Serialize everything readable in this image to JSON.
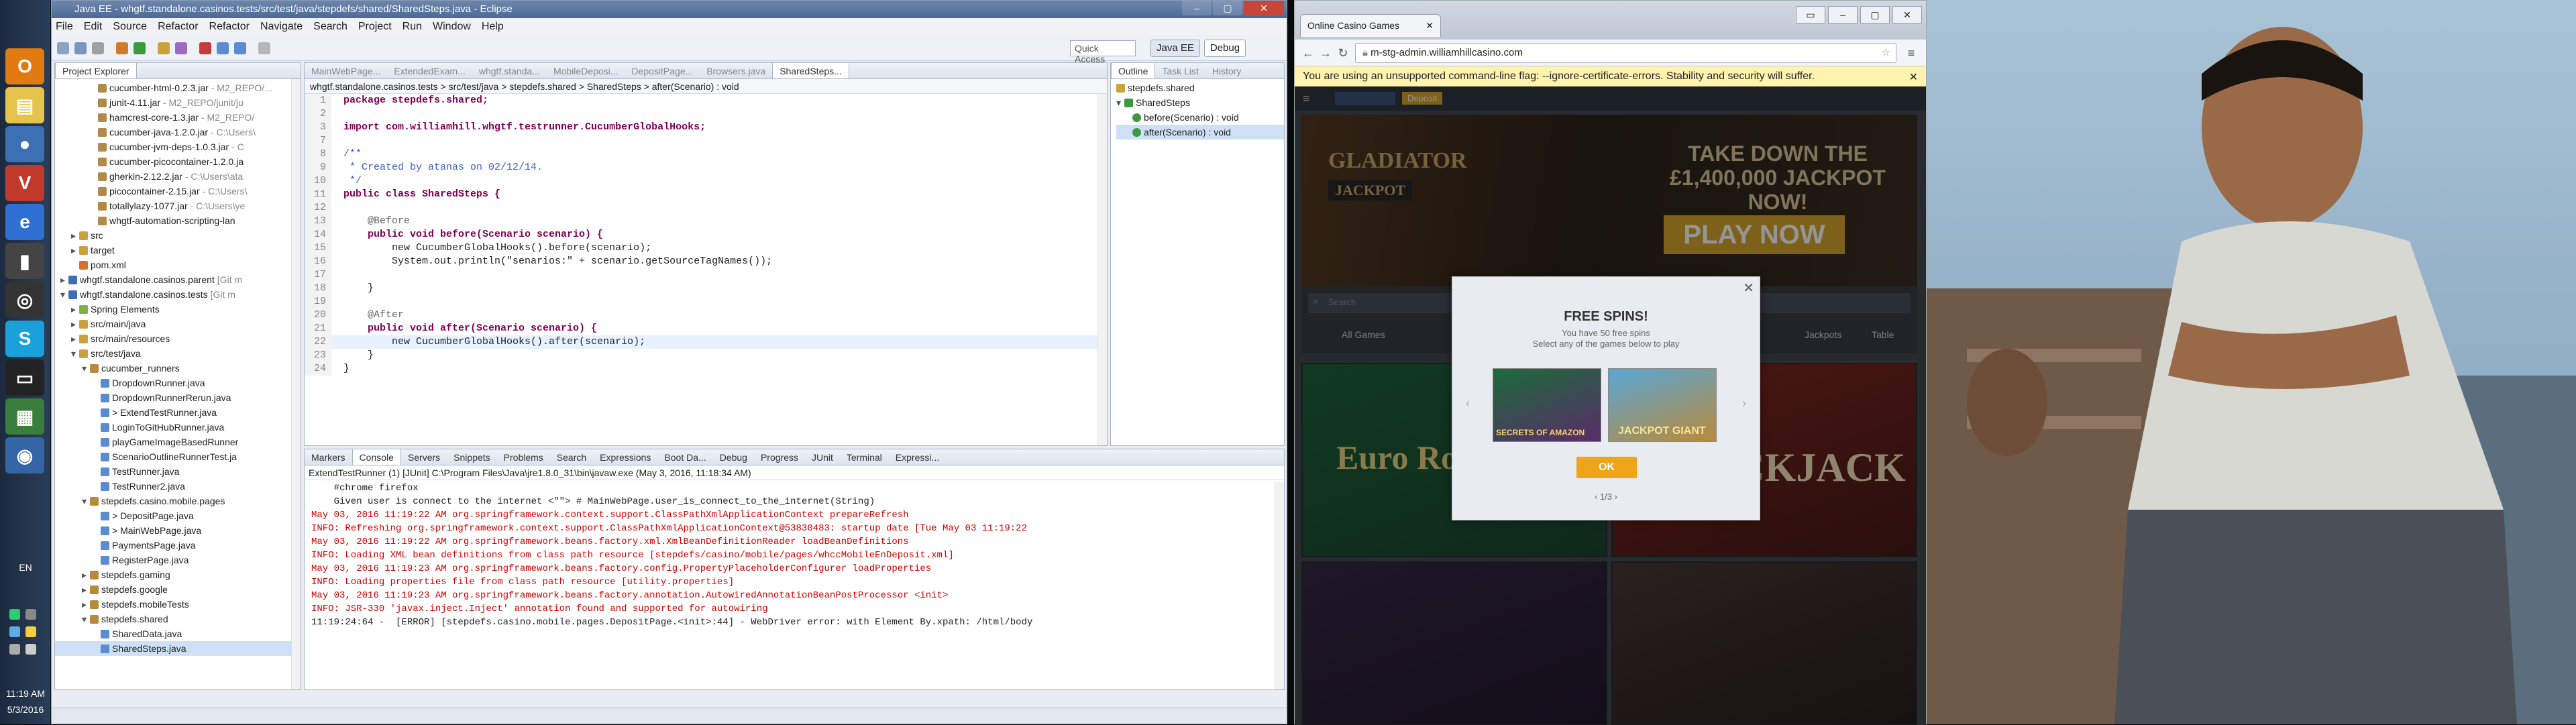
{
  "taskbar": {
    "language": "EN",
    "time": "11:19 AM",
    "date": "5/3/2016"
  },
  "eclipse": {
    "title": "Java EE - whgtf.standalone.casinos.tests/src/test/java/stepdefs/shared/SharedSteps.java - Eclipse",
    "menu": [
      "File",
      "Edit",
      "Source",
      "Refactor",
      "Refactor",
      "Navigate",
      "Search",
      "Project",
      "Run",
      "Window",
      "Help"
    ],
    "quick_access": "Quick Access",
    "perspectives": [
      "Java EE",
      "Debug"
    ],
    "project_explorer": {
      "title": "Project Explorer",
      "tabs_dim": [
        "MainWebPage...",
        "ExtendedExam...",
        "whgtf.standa...",
        "MobileDeposi...",
        "DepositPage...",
        "Browsers.java"
      ],
      "rows": [
        {
          "t": "cucumber-html-0.2.3.jar",
          "s": " - M2_REPO/..."
        },
        {
          "t": "junit-4.11.jar",
          "s": " - M2_REPO/junit/ju"
        },
        {
          "t": "hamcrest-core-1.3.jar",
          "s": " - M2_REPO/"
        },
        {
          "t": "cucumber-java-1.2.0.jar",
          "s": " - C:\\Users\\"
        },
        {
          "t": "cucumber-jvm-deps-1.0.3.jar",
          "s": " - C"
        },
        {
          "t": "cucumber-picocontainer-1.2.0.ja",
          "s": ""
        },
        {
          "t": "gherkin-2.12.2.jar",
          "s": " - C:\\Users\\ata"
        },
        {
          "t": "picocontainer-2.15.jar",
          "s": " - C:\\Users\\"
        },
        {
          "t": "totallylazy-1077.jar",
          "s": " - C:\\Users\\ye"
        },
        {
          "t": "whgtf-automation-scripting-lan",
          "s": ""
        },
        {
          "t": "src",
          "s": ""
        },
        {
          "t": "target",
          "s": ""
        },
        {
          "t": "pom.xml",
          "s": ""
        },
        {
          "t": "whgtf.standalone.casinos.parent",
          "s": " [Git m"
        },
        {
          "t": "whgtf.standalone.casinos.tests",
          "s": " [Git m"
        },
        {
          "t": "Spring Elements",
          "s": ""
        },
        {
          "t": "src/main/java",
          "s": ""
        },
        {
          "t": "src/main/resources",
          "s": ""
        },
        {
          "t": "src/test/java",
          "s": ""
        },
        {
          "t": "cucumber_runners",
          "s": ""
        },
        {
          "t": "DropdownRunner.java",
          "s": ""
        },
        {
          "t": "DropdownRunnerRerun.java",
          "s": ""
        },
        {
          "t": "> ExtendTestRunner.java",
          "s": ""
        },
        {
          "t": "LoginToGitHubRunner.java",
          "s": ""
        },
        {
          "t": "playGameImageBasedRunner",
          "s": ""
        },
        {
          "t": "ScenarioOutlineRunnerTest.ja",
          "s": ""
        },
        {
          "t": "TestRunner.java",
          "s": ""
        },
        {
          "t": "TestRunner2.java",
          "s": ""
        },
        {
          "t": "stepdefs.casino.mobile.pages",
          "s": ""
        },
        {
          "t": "> DepositPage.java",
          "s": ""
        },
        {
          "t": "> MainWebPage.java",
          "s": ""
        },
        {
          "t": "PaymentsPage.java",
          "s": ""
        },
        {
          "t": "RegisterPage.java",
          "s": ""
        },
        {
          "t": "stepdefs.gaming",
          "s": ""
        },
        {
          "t": "stepdefs.google",
          "s": ""
        },
        {
          "t": "stepdefs.mobileTests",
          "s": ""
        },
        {
          "t": "stepdefs.shared",
          "s": ""
        },
        {
          "t": "SharedData.java",
          "s": ""
        },
        {
          "t": "SharedSteps.java",
          "s": ""
        }
      ]
    },
    "editor": {
      "active_tab": "SharedSteps...",
      "breadcrumb": "whgtf.standalone.casinos.tests  >  src/test/java  >  stepdefs.shared  >  SharedSteps  >  after(Scenario) : void",
      "lines": [
        {
          "n": "1",
          "c": "package stepdefs.shared;"
        },
        {
          "n": "2",
          "c": ""
        },
        {
          "n": "3",
          "c": "import com.williamhill.whgtf.testrunner.CucumberGlobalHooks;"
        },
        {
          "n": "7",
          "c": ""
        },
        {
          "n": "8",
          "c": "/**"
        },
        {
          "n": "9",
          "c": " * Created by atanas on 02/12/14."
        },
        {
          "n": "10",
          "c": " */"
        },
        {
          "n": "11",
          "c": "public class SharedSteps {"
        },
        {
          "n": "12",
          "c": ""
        },
        {
          "n": "13",
          "c": "    @Before"
        },
        {
          "n": "14",
          "c": "    public void before(Scenario scenario) {"
        },
        {
          "n": "15",
          "c": "        new CucumberGlobalHooks().before(scenario);"
        },
        {
          "n": "16",
          "c": "        System.out.println(\"senarios:\" + scenario.getSourceTagNames());"
        },
        {
          "n": "17",
          "c": ""
        },
        {
          "n": "18",
          "c": "    }"
        },
        {
          "n": "19",
          "c": ""
        },
        {
          "n": "20",
          "c": "    @After"
        },
        {
          "n": "21",
          "c": "    public void after(Scenario scenario) {"
        },
        {
          "n": "22",
          "c": "        new CucumberGlobalHooks().after(scenario);"
        },
        {
          "n": "23",
          "c": "    }"
        },
        {
          "n": "24",
          "c": "}"
        }
      ]
    },
    "outline": {
      "tabs": [
        "Outline",
        "Task List",
        "History"
      ],
      "rows": [
        "stepdefs.shared",
        "SharedSteps",
        "before(Scenario) : void",
        "after(Scenario) : void"
      ]
    },
    "console": {
      "tabs": [
        "Markers",
        "Console",
        "Servers",
        "Snippets",
        "Problems",
        "Search",
        "Expressions",
        "Boot Da...",
        "Debug",
        "Progress",
        "JUnit",
        "Terminal",
        "Expressi..."
      ],
      "header": "ExtendTestRunner (1) [JUnit] C:\\Program Files\\Java\\jre1.8.0_31\\bin\\javaw.exe (May 3, 2016, 11:18:34 AM)",
      "lines": [
        {
          "t": "    #chrome firefox",
          "e": false
        },
        {
          "t": "    Given user is connect to the internet <\"\"> # MainWebPage.user_is_connect_to_the_internet(String)",
          "e": false
        },
        {
          "t": "May 03, 2016 11:19:22 AM org.springframework.context.support.ClassPathXmlApplicationContext prepareRefresh",
          "e": true
        },
        {
          "t": "INFO: Refreshing org.springframework.context.support.ClassPathXmlApplicationContext@53830483: startup date [Tue May 03 11:19:22",
          "e": true
        },
        {
          "t": "May 03, 2016 11:19:22 AM org.springframework.beans.factory.xml.XmlBeanDefinitionReader loadBeanDefinitions",
          "e": true
        },
        {
          "t": "INFO: Loading XML bean definitions from class path resource [stepdefs/casino/mobile/pages/whccMobileEnDeposit.xml]",
          "e": true
        },
        {
          "t": "May 03, 2016 11:19:23 AM org.springframework.beans.factory.config.PropertyPlaceholderConfigurer loadProperties",
          "e": true
        },
        {
          "t": "INFO: Loading properties file from class path resource [utility.properties]",
          "e": true
        },
        {
          "t": "May 03, 2016 11:19:23 AM org.springframework.beans.factory.annotation.AutowiredAnnotationBeanPostProcessor <init>",
          "e": true
        },
        {
          "t": "INFO: JSR-330 'javax.inject.Inject' annotation found and supported for autowiring",
          "e": true
        },
        {
          "t": "11:19:24:64 -  [ERROR] [stepdefs.casino.mobile.pages.DepositPage.<init>:44] - WebDriver error: with Element By.xpath: /html/body",
          "e": false
        }
      ]
    }
  },
  "chrome": {
    "tab_title": "Online Casino Games",
    "url": "m-stg-admin.williamhillcasino.com",
    "infobar": "You are using an unsupported command-line flag: --ignore-certificate-errors. Stability and security will suffer.",
    "site": {
      "deposit": "Deposit",
      "hero_heading": "TAKE DOWN THE £1,400,000 JACKPOT NOW!",
      "hero_button": "PLAY NOW",
      "hero_logo": "GLADIATOR",
      "hero_logo2": "JACKPOT",
      "search_placeholder": "Search",
      "categories": [
        "All Games",
        "Jackpots",
        "Table"
      ],
      "tile_roulette": "Euro Roulette",
      "tile_blackjack": "BLACKJACK"
    },
    "modal": {
      "title": "FREE SPINS!",
      "sub1": "You have 50 free spins",
      "sub2": "Select any of the games below to play",
      "game1": "SECRETS OF AMAZON",
      "game2": "JACKPOT GIANT",
      "ok": "OK",
      "page": "1/3"
    }
  },
  "colors": {
    "title_bar": "#4c6a96",
    "error_text": "#d40000",
    "ok_button": "#f0a419",
    "keyword": "#7f0055"
  }
}
